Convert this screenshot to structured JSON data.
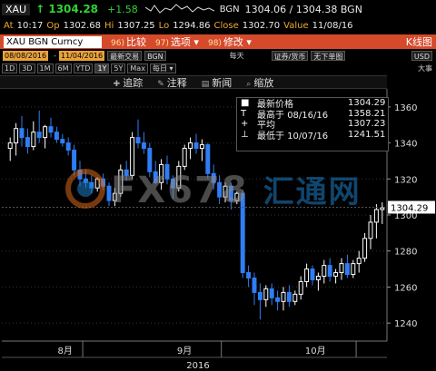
{
  "header": {
    "symbol": "XAU",
    "last": "↑ 1304.28",
    "change": "+1.58",
    "source": "BGN",
    "bid_ask": "1304.06 / 1304.38 BGN",
    "at_label": "At",
    "at_value": "10:17",
    "op_label": "Op",
    "op_value": "1302.68",
    "hi_label": "Hi",
    "hi_value": "1307.25",
    "lo_label": "Lo",
    "lo_value": "1294.86",
    "close_label": "Close",
    "close_value": "1302.70",
    "value_label": "Value",
    "value_value": "11/08/16"
  },
  "toolbar": {
    "title": "XAU BGN Curncy",
    "items": [
      {
        "n": "96)",
        "label": "比较"
      },
      {
        "n": "97)",
        "label": "选项 ▾"
      },
      {
        "n": "98)",
        "label": "修改 ▾"
      }
    ],
    "right_label": "K线图"
  },
  "date_bar": {
    "start": "08/08/2016",
    "end": "11/04/2016",
    "field": "最新交易",
    "source": "BGN",
    "period_label": "每天",
    "currency_label": "证券/货币",
    "mode_label": "无下单图",
    "ccy": "USD"
  },
  "periods": [
    "1D",
    "3D",
    "1M",
    "6M",
    "YTD",
    "1Y",
    "5Y",
    "Max",
    "每日 ▾"
  ],
  "periods_selected": "1Y",
  "right_tools": "大事",
  "actions": [
    {
      "label": "追踪",
      "icon": "track-icon"
    },
    {
      "label": "注释",
      "icon": "annotate-icon"
    },
    {
      "label": "新闻",
      "icon": "news-icon"
    },
    {
      "label": "缩放",
      "icon": "zoom-icon"
    }
  ],
  "legend": [
    {
      "marker": "■",
      "label": "最新价格",
      "date": "",
      "value": "1304.29"
    },
    {
      "marker": "T",
      "label": "最高于",
      "date": "08/16/16",
      "value": "1358.21"
    },
    {
      "marker": "+",
      "label": "平均",
      "date": "",
      "value": "1307.23"
    },
    {
      "marker": "⊥",
      "label": "最低于",
      "date": "10/07/16",
      "value": "1241.51"
    }
  ],
  "watermark": {
    "latin": "FX678",
    "cn": "汇通网"
  },
  "colors": {
    "up": "#ffffff",
    "down": "#2f7df5",
    "header_bar": "#d64a2c",
    "price_green": "#32d232"
  },
  "chart_data": {
    "type": "candlestick",
    "ylim": [
      1230,
      1370
    ],
    "yticks": [
      1240,
      1260,
      1280,
      1300,
      1320,
      1340,
      1360
    ],
    "xticks": [
      "8月",
      "9月",
      "10月"
    ],
    "year_label": "2016",
    "last_price_label": "1304.29",
    "candles": [
      {
        "o": 1337,
        "h": 1343,
        "l": 1330,
        "c": 1340
      },
      {
        "o": 1340,
        "h": 1351,
        "l": 1333,
        "c": 1348
      },
      {
        "o": 1348,
        "h": 1355,
        "l": 1338,
        "c": 1343
      },
      {
        "o": 1343,
        "h": 1348,
        "l": 1334,
        "c": 1338
      },
      {
        "o": 1338,
        "h": 1352,
        "l": 1336,
        "c": 1346
      },
      {
        "o": 1346,
        "h": 1358,
        "l": 1340,
        "c": 1343
      },
      {
        "o": 1343,
        "h": 1350,
        "l": 1337,
        "c": 1349
      },
      {
        "o": 1349,
        "h": 1354,
        "l": 1343,
        "c": 1346
      },
      {
        "o": 1346,
        "h": 1349,
        "l": 1340,
        "c": 1342
      },
      {
        "o": 1342,
        "h": 1345,
        "l": 1338,
        "c": 1340
      },
      {
        "o": 1340,
        "h": 1343,
        "l": 1333,
        "c": 1336
      },
      {
        "o": 1336,
        "h": 1339,
        "l": 1322,
        "c": 1325
      },
      {
        "o": 1325,
        "h": 1330,
        "l": 1316,
        "c": 1320
      },
      {
        "o": 1320,
        "h": 1325,
        "l": 1315,
        "c": 1318
      },
      {
        "o": 1318,
        "h": 1322,
        "l": 1312,
        "c": 1315
      },
      {
        "o": 1315,
        "h": 1321,
        "l": 1313,
        "c": 1320
      },
      {
        "o": 1320,
        "h": 1323,
        "l": 1314,
        "c": 1316
      },
      {
        "o": 1316,
        "h": 1318,
        "l": 1305,
        "c": 1308
      },
      {
        "o": 1308,
        "h": 1315,
        "l": 1305,
        "c": 1312
      },
      {
        "o": 1312,
        "h": 1328,
        "l": 1310,
        "c": 1325
      },
      {
        "o": 1325,
        "h": 1330,
        "l": 1319,
        "c": 1322
      },
      {
        "o": 1322,
        "h": 1346,
        "l": 1320,
        "c": 1343
      },
      {
        "o": 1343,
        "h": 1353,
        "l": 1337,
        "c": 1340
      },
      {
        "o": 1340,
        "h": 1346,
        "l": 1334,
        "c": 1337
      },
      {
        "o": 1337,
        "h": 1340,
        "l": 1321,
        "c": 1324
      },
      {
        "o": 1324,
        "h": 1330,
        "l": 1317,
        "c": 1318
      },
      {
        "o": 1318,
        "h": 1331,
        "l": 1314,
        "c": 1328
      },
      {
        "o": 1328,
        "h": 1333,
        "l": 1317,
        "c": 1320
      },
      {
        "o": 1320,
        "h": 1322,
        "l": 1309,
        "c": 1315
      },
      {
        "o": 1315,
        "h": 1330,
        "l": 1313,
        "c": 1327
      },
      {
        "o": 1327,
        "h": 1339,
        "l": 1325,
        "c": 1337
      },
      {
        "o": 1337,
        "h": 1343,
        "l": 1331,
        "c": 1340
      },
      {
        "o": 1340,
        "h": 1345,
        "l": 1334,
        "c": 1337
      },
      {
        "o": 1337,
        "h": 1342,
        "l": 1330,
        "c": 1339
      },
      {
        "o": 1339,
        "h": 1340,
        "l": 1320,
        "c": 1323
      },
      {
        "o": 1323,
        "h": 1328,
        "l": 1314,
        "c": 1318
      },
      {
        "o": 1318,
        "h": 1322,
        "l": 1306,
        "c": 1310
      },
      {
        "o": 1310,
        "h": 1318,
        "l": 1307,
        "c": 1316
      },
      {
        "o": 1316,
        "h": 1318,
        "l": 1303,
        "c": 1308
      },
      {
        "o": 1308,
        "h": 1313,
        "l": 1306,
        "c": 1312
      },
      {
        "o": 1312,
        "h": 1314,
        "l": 1265,
        "c": 1268
      },
      {
        "o": 1268,
        "h": 1272,
        "l": 1260,
        "c": 1265
      },
      {
        "o": 1265,
        "h": 1268,
        "l": 1250,
        "c": 1257
      },
      {
        "o": 1257,
        "h": 1262,
        "l": 1242,
        "c": 1253
      },
      {
        "o": 1253,
        "h": 1261,
        "l": 1249,
        "c": 1259
      },
      {
        "o": 1259,
        "h": 1262,
        "l": 1250,
        "c": 1254
      },
      {
        "o": 1254,
        "h": 1258,
        "l": 1247,
        "c": 1252
      },
      {
        "o": 1252,
        "h": 1260,
        "l": 1247,
        "c": 1257
      },
      {
        "o": 1257,
        "h": 1261,
        "l": 1249,
        "c": 1252
      },
      {
        "o": 1252,
        "h": 1258,
        "l": 1250,
        "c": 1256
      },
      {
        "o": 1256,
        "h": 1266,
        "l": 1253,
        "c": 1263
      },
      {
        "o": 1263,
        "h": 1273,
        "l": 1260,
        "c": 1270
      },
      {
        "o": 1270,
        "h": 1272,
        "l": 1261,
        "c": 1264
      },
      {
        "o": 1264,
        "h": 1268,
        "l": 1258,
        "c": 1266
      },
      {
        "o": 1266,
        "h": 1275,
        "l": 1262,
        "c": 1272
      },
      {
        "o": 1272,
        "h": 1276,
        "l": 1263,
        "c": 1266
      },
      {
        "o": 1266,
        "h": 1270,
        "l": 1262,
        "c": 1268
      },
      {
        "o": 1268,
        "h": 1276,
        "l": 1264,
        "c": 1273
      },
      {
        "o": 1273,
        "h": 1278,
        "l": 1265,
        "c": 1267
      },
      {
        "o": 1267,
        "h": 1275,
        "l": 1265,
        "c": 1273
      },
      {
        "o": 1273,
        "h": 1280,
        "l": 1268,
        "c": 1276
      },
      {
        "o": 1276,
        "h": 1290,
        "l": 1274,
        "c": 1287
      },
      {
        "o": 1287,
        "h": 1300,
        "l": 1281,
        "c": 1296
      },
      {
        "o": 1296,
        "h": 1306,
        "l": 1287,
        "c": 1303
      },
      {
        "o": 1303,
        "h": 1307,
        "l": 1295,
        "c": 1304
      }
    ]
  }
}
